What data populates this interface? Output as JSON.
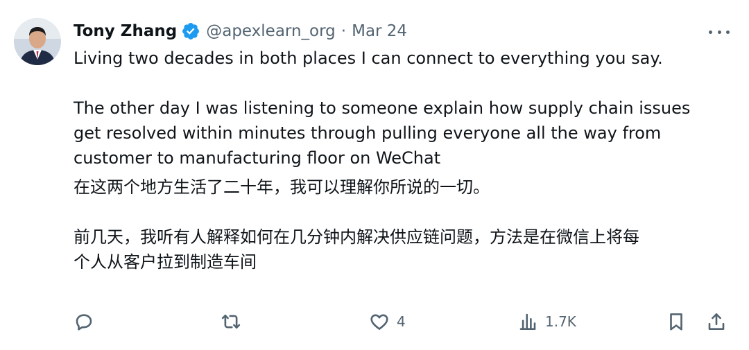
{
  "author": {
    "name": "Tony Zhang",
    "handle": "@apexlearn_org",
    "separator": "·",
    "date": "Mar 24"
  },
  "tweet": {
    "paragraph_en_1": "Living two decades in both places I can connect to everything you say.",
    "paragraph_en_2_line1": "The other day I was listening to someone explain how supply chain issues",
    "paragraph_en_2_line2": "get resolved within minutes through pulling everyone all the way from",
    "paragraph_en_2_line3": "customer to manufacturing floor on WeChat",
    "paragraph_zh_1": "在这两个地方生活了二十年，我可以理解你所说的一切。",
    "paragraph_zh_2_line1": "前几天，我听有人解释如何在几分钟内解决供应链问题，方法是在微信上将每",
    "paragraph_zh_2_line2": "个人从客户拉到制造车间"
  },
  "actions": {
    "reply_icon": "reply-icon",
    "retweet_icon": "retweet-icon",
    "like_icon": "heart-icon",
    "like_count": "4",
    "views_icon": "views-bar-chart-icon",
    "views_count": "1.7K",
    "bookmark_icon": "bookmark-icon",
    "share_icon": "share-icon"
  },
  "colors": {
    "text": "#0f1419",
    "secondary": "#536471",
    "verified": "#1d9bf0"
  }
}
